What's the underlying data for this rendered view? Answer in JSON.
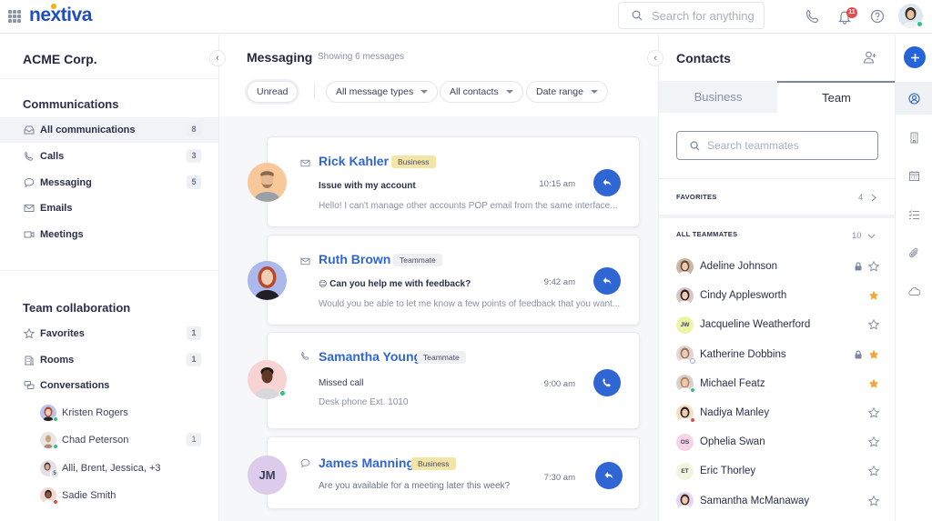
{
  "app": {
    "brand": "nextiva",
    "search_placeholder": "Search for anything",
    "notification_count": "11",
    "icons": [
      "apps-grid-icon",
      "phone-icon",
      "bell-icon",
      "help-icon",
      "user-avatar"
    ]
  },
  "left_sidebar": {
    "org_name": "ACME Corp.",
    "communications": {
      "title": "Communications",
      "items": [
        {
          "label": "All communications",
          "count": "8",
          "icon": "inbox-icon",
          "active": true
        },
        {
          "label": "Calls",
          "count": "3",
          "icon": "phone-icon"
        },
        {
          "label": "Messaging",
          "count": "5",
          "icon": "chat-bubble-icon"
        },
        {
          "label": "Emails",
          "count": "",
          "icon": "envelope-icon"
        },
        {
          "label": "Meetings",
          "count": "",
          "icon": "video-icon"
        }
      ]
    },
    "team_collaboration": {
      "title": "Team collaboration",
      "items": [
        {
          "label": "Favorites",
          "count": "1",
          "icon": "star-icon"
        },
        {
          "label": "Rooms",
          "count": "1",
          "icon": "building-icon"
        },
        {
          "label": "Conversations",
          "count": "",
          "icon": "conversations-icon"
        }
      ],
      "conversations": [
        {
          "name": "Kristen Rogers",
          "count": "",
          "presence": "online",
          "avatar_bg": "#b8c4ef"
        },
        {
          "name": "Chad Peterson",
          "count": "1",
          "presence": "online",
          "avatar_bg": "#e9e6e1"
        },
        {
          "name": "Alli, Brent, Jessica, +3",
          "count": "",
          "presence": "group",
          "group_count": "5",
          "avatar_bg": "#e6dfe6"
        },
        {
          "name": "Sadie Smith",
          "count": "",
          "presence": "busy",
          "avatar_bg": "#f6d6d4"
        }
      ]
    }
  },
  "messaging": {
    "title": "Messaging",
    "subtitle": "Showing 6 messages",
    "filters": {
      "unread": "Unread",
      "types": "All message types",
      "contacts": "All contacts",
      "date": "Date range"
    },
    "messages": [
      {
        "name": "Rick Kahler",
        "tag": "Business",
        "type_icon": "envelope-icon",
        "subject": "Issue with my account",
        "preview": "Hello! I can't manage other accounts POP email from the same interface...",
        "time": "10:15 am",
        "action": "reply",
        "avatar_bg": "#f9c89a"
      },
      {
        "name": "Ruth Brown",
        "tag": "Teammate",
        "type_icon": "envelope-icon",
        "subject": "Can you help me with feedback?",
        "emoji": "😑",
        "preview": "Would you be able to let me know a few points of feedback that you want...",
        "time": "9:42 am",
        "action": "reply",
        "avatar_bg": "#aab8ec"
      },
      {
        "name": "Samantha Young",
        "tag": "Teammate",
        "type_icon": "phone-icon",
        "subject": "Missed call",
        "preview": "Desk phone Ext. 1010",
        "time": "9:00 am",
        "action": "call",
        "avatar_bg": "#f8d3d3"
      },
      {
        "name": "James Manning",
        "tag": "Business",
        "type_icon": "chat-bubble-icon",
        "subject": "",
        "preview": "Are you available for a meeting later this week?",
        "time": "7:30 am",
        "action": "reply",
        "initials": "JM",
        "avatar_bg": "#dccbea"
      }
    ]
  },
  "contacts": {
    "title": "Contacts",
    "tabs": [
      "Business",
      "Team"
    ],
    "active_tab": "Team",
    "search_placeholder": "Search teammates",
    "favorites_label": "FAVORITES",
    "favorites_count": "4",
    "all_label": "ALL TEAMMATES",
    "all_count": "10",
    "teammates": [
      {
        "name": "Adeline Johnson",
        "locked": true,
        "favorite": false,
        "avatar_bg": "#c9b7a4"
      },
      {
        "name": "Cindy Applesworth",
        "locked": false,
        "favorite": true,
        "avatar_bg": "#d8c6c6"
      },
      {
        "name": "Jacqueline Weatherford",
        "locked": false,
        "favorite": false,
        "initials": "JW",
        "avatar_bg": "#ecf4a8"
      },
      {
        "name": "Katherine Dobbins",
        "locked": true,
        "favorite": true,
        "presence": "away",
        "avatar_bg": "#e8d4cc"
      },
      {
        "name": "Michael Featz",
        "locked": false,
        "favorite": true,
        "presence": "online",
        "avatar_bg": "#d7d2cd"
      },
      {
        "name": "Nadiya Manley",
        "locked": false,
        "favorite": false,
        "presence": "busy",
        "avatar_bg": "#f1e1c2"
      },
      {
        "name": "Ophelia Swan",
        "locked": false,
        "favorite": false,
        "initials": "OS",
        "avatar_bg": "#f7d3e6"
      },
      {
        "name": "Eric Thorley",
        "locked": false,
        "favorite": false,
        "initials": "ET",
        "avatar_bg": "#f1f5db"
      },
      {
        "name": "Samantha McManaway",
        "locked": false,
        "favorite": false,
        "avatar_bg": "#e6d6f0"
      }
    ]
  },
  "rail": {
    "items": [
      "add-icon",
      "contacts-icon",
      "building-icon",
      "calendar-icon",
      "tasks-icon",
      "attachment-icon",
      "cloud-icon"
    ],
    "active": "contacts-icon"
  },
  "colors": {
    "brand": "#1f4fbf",
    "accent": "#2f66d4",
    "online": "#2ec27e",
    "busy": "#e5484d",
    "favorite": "#f2a93b"
  }
}
